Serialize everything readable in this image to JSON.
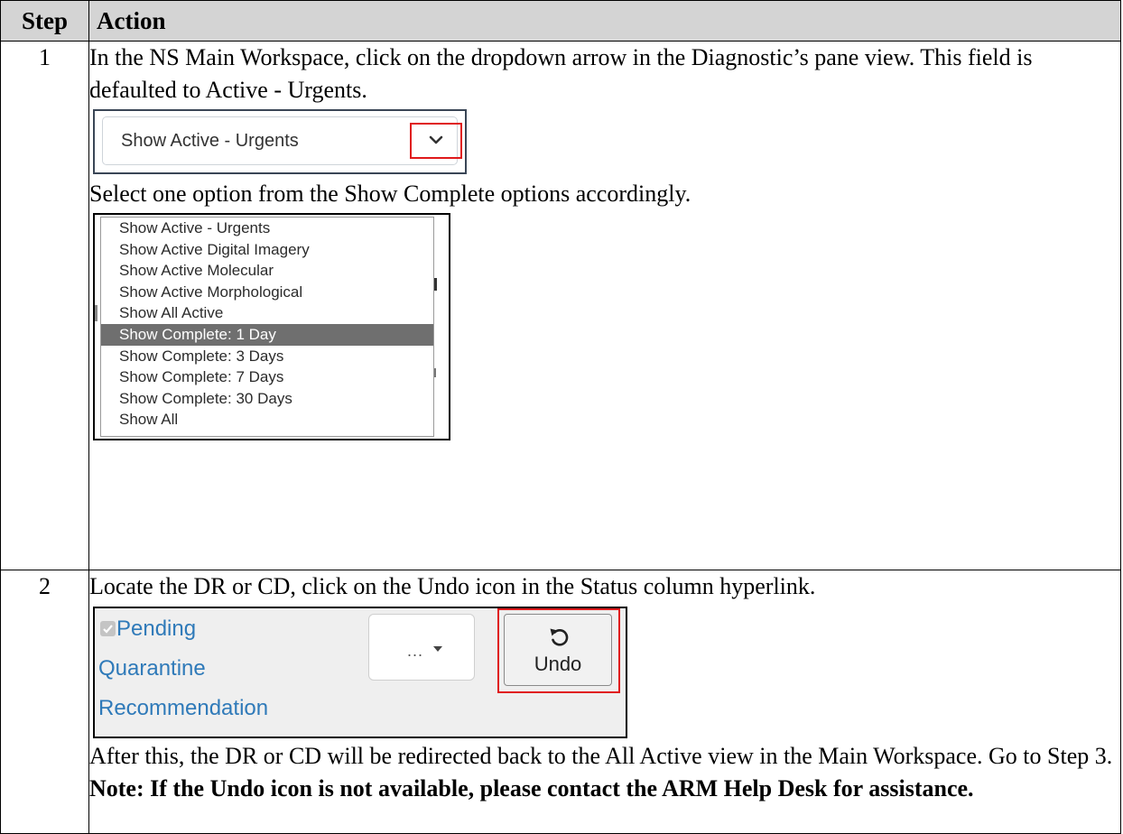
{
  "table": {
    "header": {
      "step": "Step",
      "action": "Action"
    },
    "rows": [
      {
        "step": "1",
        "intro": "In the NS Main Workspace, click on the dropdown arrow in the Diagnostic’s pane view. This field is defaulted to Active - Urgents.",
        "select_value": "Show Active - Urgents",
        "select_text": "Select one option from the Show Complete options accordingly.",
        "options": [
          "Show Active - Urgents",
          "Show Active Digital Imagery",
          "Show Active Molecular",
          "Show Active Morphological",
          "Show All Active",
          "Show Complete: 1 Day",
          "Show Complete: 3 Days",
          "Show Complete: 7 Days",
          "Show Complete: 30 Days",
          "Show All"
        ],
        "selected_option": "Show Complete: 1 Day"
      },
      {
        "step": "2",
        "intro": "Locate the DR or CD, click on the Undo icon in the Status column hyperlink.",
        "status_link": [
          "Pending",
          "Quarantine",
          "Recommendation"
        ],
        "menu_dots": "...",
        "undo_label": "Undo",
        "outro": "After this, the DR or CD will be redirected back to the All Active view in the Main Workspace. Go to Step 3. ",
        "note": "Note: If the Undo icon is not available, please contact the ARM Help Desk for assistance."
      }
    ]
  },
  "colors": {
    "header_bg": "#d4d4d4",
    "highlight_red": "#e0191b",
    "link_blue": "#2f7ab9",
    "selected_bg": "#6f6f6f"
  },
  "icons": {
    "dropdown": "chevron-down-icon",
    "undo": "undo-icon",
    "checkbox": "checkbox-icon",
    "caret": "caret-down-icon"
  }
}
